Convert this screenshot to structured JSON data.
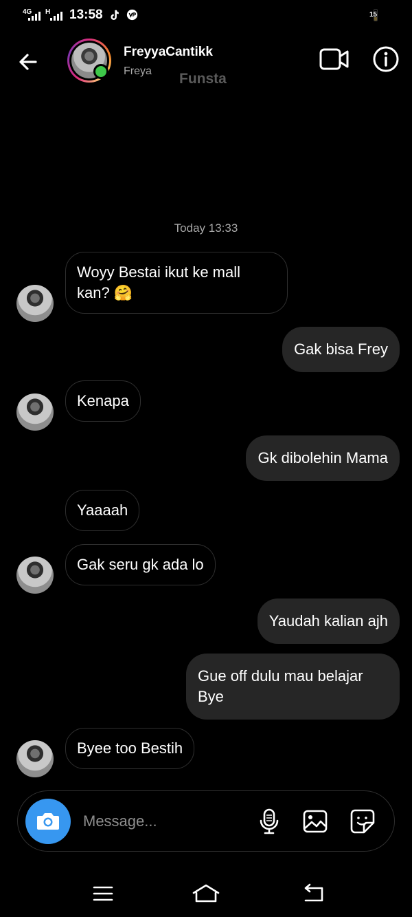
{
  "status_bar": {
    "network_1": "4G",
    "network_2": "H",
    "time": "13:58",
    "battery_level": "15",
    "icons": [
      "tiktok-icon",
      "vpn-icon",
      "battery-icon"
    ]
  },
  "header": {
    "contact_name": "FreyyaCantikk",
    "contact_subtitle": "Freya",
    "contact_tag": "Funsta",
    "online": true,
    "icons": [
      "back-arrow-icon",
      "video-call-icon",
      "info-icon"
    ]
  },
  "chat": {
    "timestamp": "Today 13:33",
    "messages": [
      {
        "from": "them",
        "text": "Woyy Bestai ikut ke mall kan? 🤗",
        "avatar": true
      },
      {
        "from": "me",
        "text": "Gak bisa Frey"
      },
      {
        "from": "them",
        "text": "Kenapa",
        "avatar": true
      },
      {
        "from": "me",
        "text": "Gk dibolehin Mama"
      },
      {
        "from": "them",
        "text": "Yaaaah",
        "avatar": false
      },
      {
        "from": "them",
        "text": "Gak seru gk ada lo",
        "avatar": true
      },
      {
        "from": "me",
        "text": "Yaudah kalian ajh"
      },
      {
        "from": "me",
        "text": "Gue off dulu mau belajar Bye"
      },
      {
        "from": "them",
        "text": "Byee too Bestih",
        "avatar": true
      }
    ]
  },
  "composer": {
    "placeholder": "Message...",
    "value": "",
    "icons": [
      "camera-icon",
      "microphone-icon",
      "gallery-icon",
      "sticker-icon"
    ]
  },
  "navbar": {
    "icons": [
      "menu-icon",
      "home-icon",
      "back-icon"
    ]
  },
  "colors": {
    "background": "#000000",
    "outgoing_bubble": "#262626",
    "incoming_border": "#2f2f2f",
    "camera_button": "#3797f0",
    "online_dot": "#3ec84a",
    "secondary_text": "#a8a8a8"
  }
}
